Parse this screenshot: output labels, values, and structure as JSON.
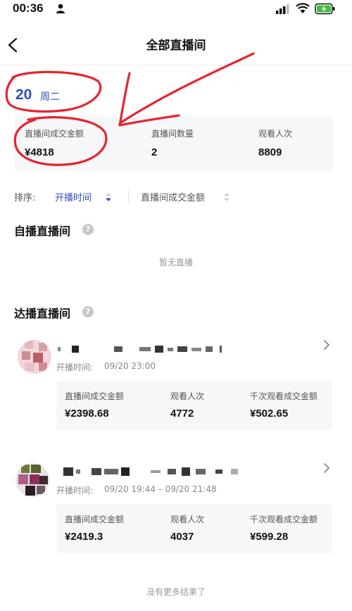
{
  "status_bar": {
    "time": "00:36"
  },
  "nav": {
    "title": "全部直播间"
  },
  "date": {
    "day": "20",
    "weekday": "周二"
  },
  "summary": [
    {
      "label": "直播间成交金额",
      "value": "¥4818"
    },
    {
      "label": "直播间数量",
      "value": "2"
    },
    {
      "label": "观看人次",
      "value": "8809"
    }
  ],
  "sort": {
    "label": "排序:",
    "active": "开播时间",
    "other": "直播间成交金额"
  },
  "self_section": {
    "title": "自播直播间",
    "empty": "暂无直播"
  },
  "talent_section": {
    "title": "达播直播间"
  },
  "rooms": [
    {
      "time_label": "开播时间:",
      "time": "09/20 23:00",
      "stats": [
        {
          "label": "直播间成交金额",
          "value": "¥2398.68"
        },
        {
          "label": "观看人次",
          "value": "4772"
        },
        {
          "label": "千次观看成交金额",
          "value": "¥502.65"
        }
      ]
    },
    {
      "time_label": "开播时间:",
      "time": "09/20 19:44 – 09/20 21:48",
      "stats": [
        {
          "label": "直播间成交金额",
          "value": "¥2419.3"
        },
        {
          "label": "观看人次",
          "value": "4037"
        },
        {
          "label": "千次观看成交金额",
          "value": "¥599.28"
        }
      ]
    }
  ],
  "footer": {
    "no_more": "没有更多结果了"
  },
  "colors": {
    "accent": "#2f4fbf",
    "annotation": "#e8232d",
    "card_bg": "#f6f7f9"
  },
  "icons": [
    "person-icon",
    "signal-icon",
    "wifi-icon",
    "battery-charging-icon",
    "back-arrow-icon",
    "sort-toggle-icon",
    "help-icon",
    "chevron-right-icon"
  ]
}
